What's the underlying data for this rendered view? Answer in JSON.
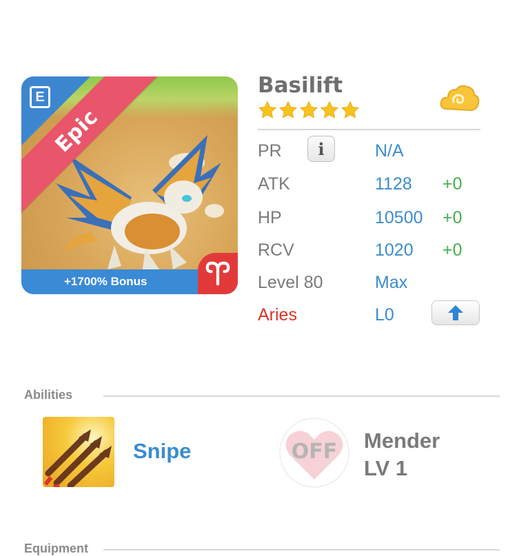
{
  "card": {
    "rarity": "Epic",
    "bonus": "+1700% Bonus",
    "badge_letter": "E",
    "colors": {
      "rarity_banner": "#e9556a",
      "bonus_bar": "#3a8ad6",
      "zodiac_corner": "#e23a3a"
    }
  },
  "monster": {
    "name": "Basilift",
    "stars": 5,
    "stats": {
      "pr": {
        "label": "PR",
        "value": "N/A"
      },
      "atk": {
        "label": "ATK",
        "value": "1128",
        "bonus": "+0"
      },
      "hp": {
        "label": "HP",
        "value": "10500",
        "bonus": "+0"
      },
      "rcv": {
        "label": "RCV",
        "value": "1020",
        "bonus": "+0"
      },
      "level": {
        "label": "Level 80",
        "value": "Max"
      },
      "zodiac": {
        "label": "Aries",
        "value": "L0"
      }
    }
  },
  "abilities": {
    "title": "Abilities",
    "active": {
      "name": "Snipe"
    },
    "passive": {
      "status": "OFF",
      "name": "Mender",
      "level": "LV 1"
    }
  },
  "equipment": {
    "title": "Equipment"
  },
  "colors": {
    "value_blue": "#3b8ccf",
    "bonus_green": "#43b04a",
    "aries_red": "#d9352b",
    "label_gray": "#7a7a7a"
  }
}
